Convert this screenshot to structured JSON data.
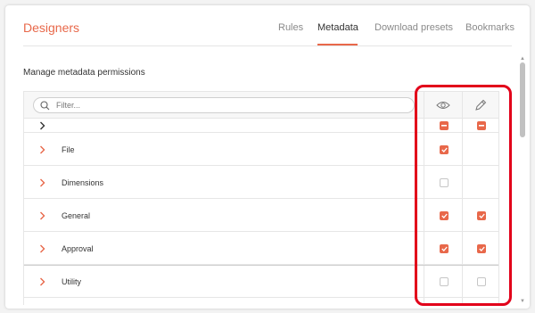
{
  "header": {
    "title": "Designers",
    "tabs": [
      {
        "label": "Rules",
        "active": false
      },
      {
        "label": "Metadata",
        "active": true
      },
      {
        "label": "Download presets",
        "active": false
      },
      {
        "label": "Bookmarks",
        "active": false
      }
    ]
  },
  "section": {
    "title": "Manage metadata permissions"
  },
  "filter": {
    "placeholder": "Filter...",
    "value": ""
  },
  "columns": [
    {
      "icon": "eye-icon",
      "meaning": "view"
    },
    {
      "icon": "pencil-icon",
      "meaning": "edit"
    }
  ],
  "rows": [
    {
      "label": "",
      "view": "partial",
      "edit": "partial"
    },
    {
      "label": "File",
      "view": "checked",
      "edit": "none"
    },
    {
      "label": "Dimensions",
      "view": "empty",
      "edit": "none"
    },
    {
      "label": "General",
      "view": "checked",
      "edit": "checked"
    },
    {
      "label": "Approval",
      "view": "checked",
      "edit": "checked"
    },
    {
      "label": "Utility",
      "view": "empty",
      "edit": "empty"
    }
  ],
  "colors": {
    "accent": "#e8684a",
    "highlight": "#e2001a"
  }
}
